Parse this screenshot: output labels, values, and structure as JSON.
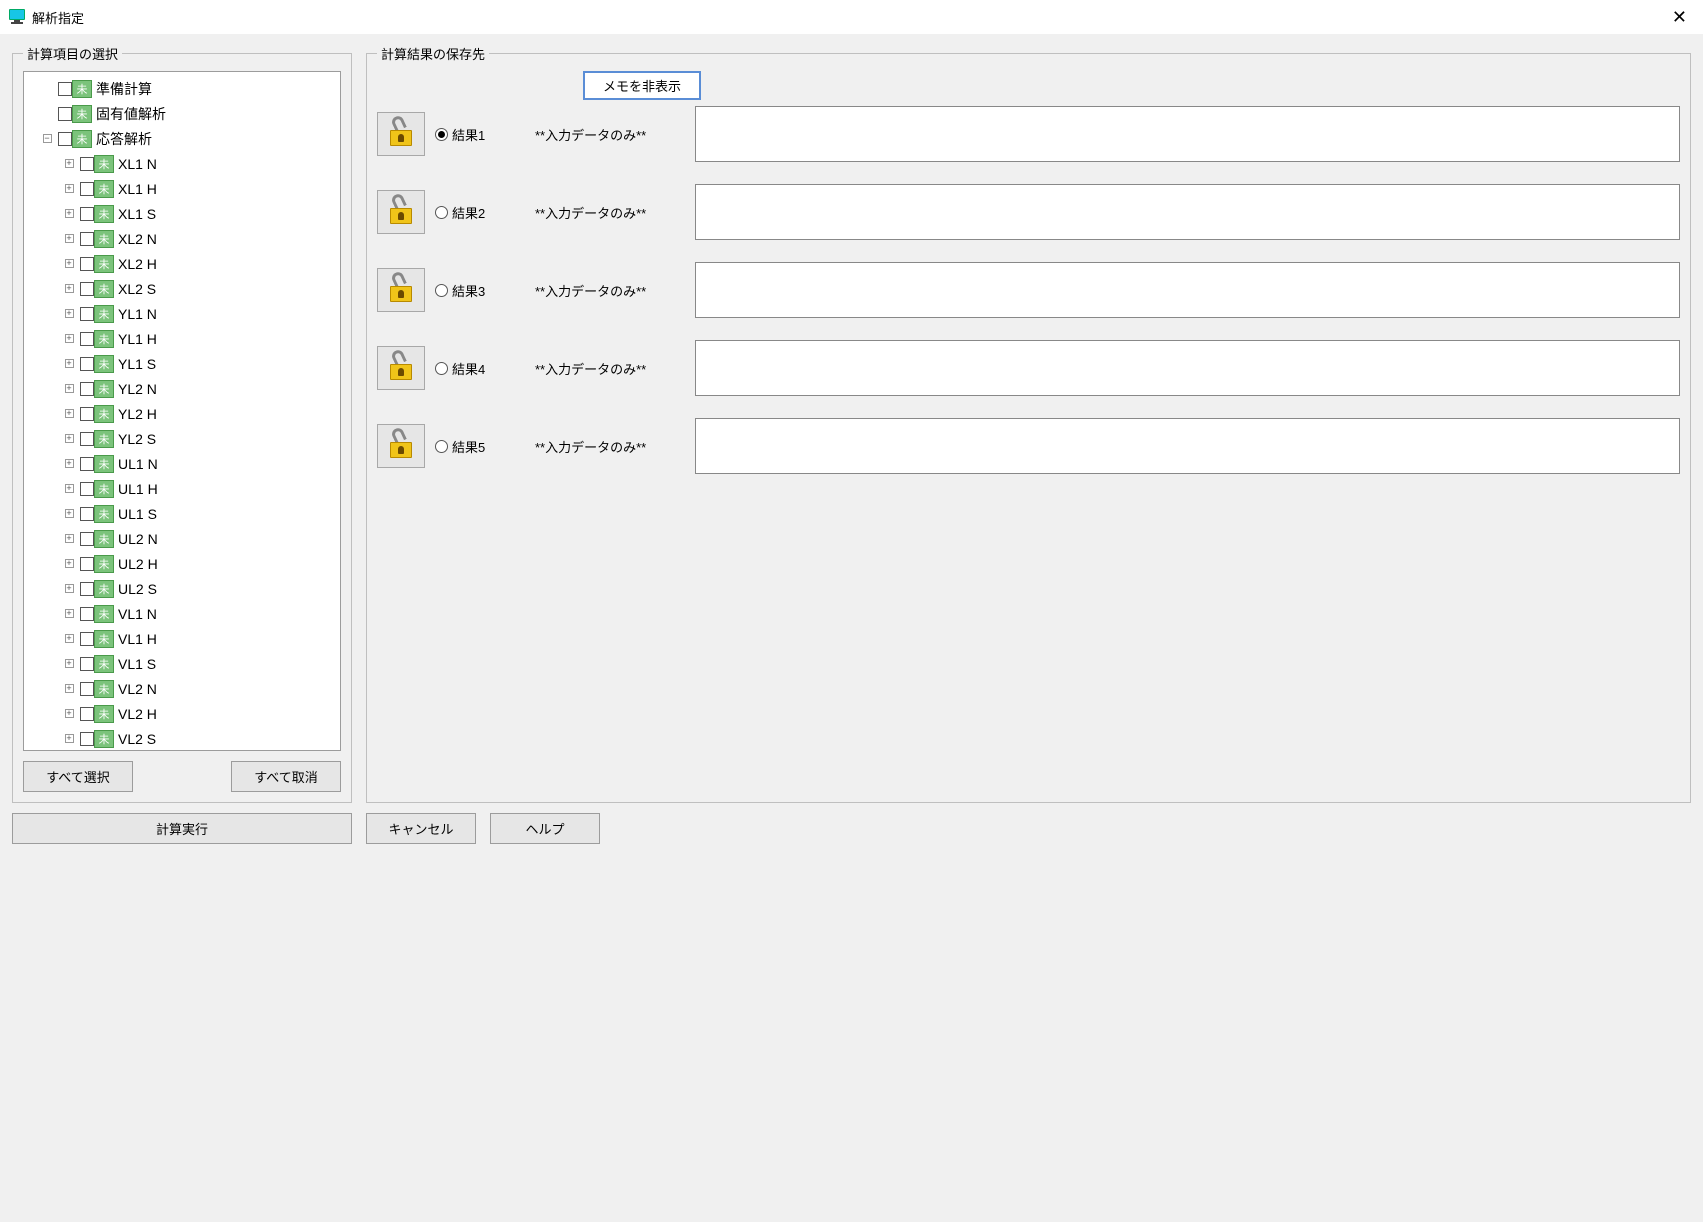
{
  "title": "解析指定",
  "leftPanel": {
    "legend": "計算項目の選択",
    "statusGlyph": "未",
    "items": [
      {
        "label": "準備計算",
        "level": 0,
        "expander": ""
      },
      {
        "label": "固有値解析",
        "level": 0,
        "expander": ""
      },
      {
        "label": "応答解析",
        "level": 0,
        "expander": "-"
      },
      {
        "label": "XL1 N",
        "level": 1,
        "expander": "+"
      },
      {
        "label": "XL1 H",
        "level": 1,
        "expander": "+"
      },
      {
        "label": "XL1 S",
        "level": 1,
        "expander": "+"
      },
      {
        "label": "XL2 N",
        "level": 1,
        "expander": "+"
      },
      {
        "label": "XL2 H",
        "level": 1,
        "expander": "+"
      },
      {
        "label": "XL2 S",
        "level": 1,
        "expander": "+"
      },
      {
        "label": "YL1 N",
        "level": 1,
        "expander": "+"
      },
      {
        "label": "YL1 H",
        "level": 1,
        "expander": "+"
      },
      {
        "label": "YL1 S",
        "level": 1,
        "expander": "+"
      },
      {
        "label": "YL2 N",
        "level": 1,
        "expander": "+"
      },
      {
        "label": "YL2 H",
        "level": 1,
        "expander": "+"
      },
      {
        "label": "YL2 S",
        "level": 1,
        "expander": "+"
      },
      {
        "label": "UL1 N",
        "level": 1,
        "expander": "+"
      },
      {
        "label": "UL1 H",
        "level": 1,
        "expander": "+"
      },
      {
        "label": "UL1 S",
        "level": 1,
        "expander": "+"
      },
      {
        "label": "UL2 N",
        "level": 1,
        "expander": "+"
      },
      {
        "label": "UL2 H",
        "level": 1,
        "expander": "+"
      },
      {
        "label": "UL2 S",
        "level": 1,
        "expander": "+"
      },
      {
        "label": "VL1 N",
        "level": 1,
        "expander": "+"
      },
      {
        "label": "VL1 H",
        "level": 1,
        "expander": "+"
      },
      {
        "label": "VL1 S",
        "level": 1,
        "expander": "+"
      },
      {
        "label": "VL2 N",
        "level": 1,
        "expander": "+"
      },
      {
        "label": "VL2 H",
        "level": 1,
        "expander": "+"
      },
      {
        "label": "VL2 S",
        "level": 1,
        "expander": "+"
      }
    ],
    "selectAll": "すべて選択",
    "deselectAll": "すべて取消"
  },
  "rightPanel": {
    "legend": "計算結果の保存先",
    "hideMemo": "メモを非表示",
    "results": [
      {
        "label": "結果1",
        "status": "**入力データのみ**",
        "selected": true
      },
      {
        "label": "結果2",
        "status": "**入力データのみ**",
        "selected": false
      },
      {
        "label": "結果3",
        "status": "**入力データのみ**",
        "selected": false
      },
      {
        "label": "結果4",
        "status": "**入力データのみ**",
        "selected": false
      },
      {
        "label": "結果5",
        "status": "**入力データのみ**",
        "selected": false
      }
    ]
  },
  "buttons": {
    "run": "計算実行",
    "cancel": "キャンセル",
    "help": "ヘルプ"
  }
}
